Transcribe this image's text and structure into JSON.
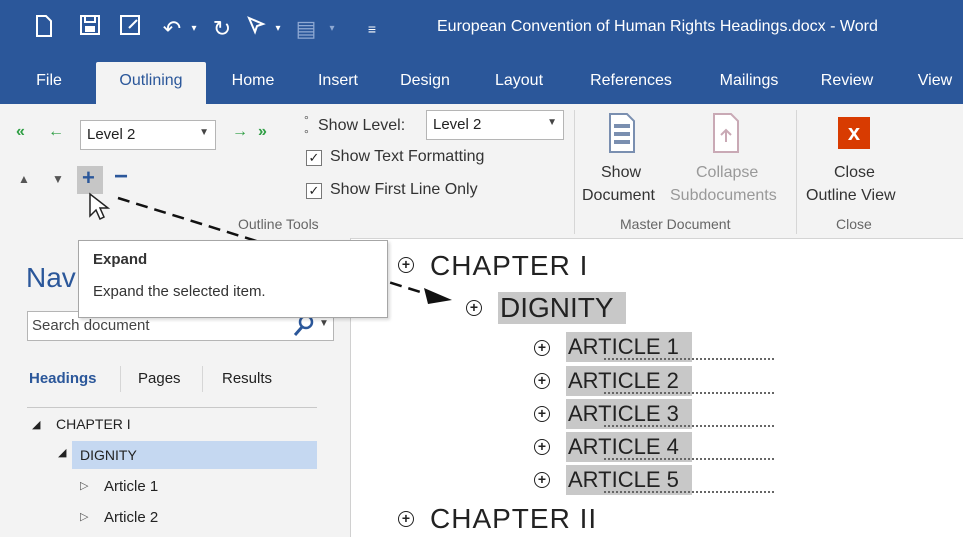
{
  "window": {
    "title": "European Convention of Human Rights Headings.docx  -  Word"
  },
  "tabs": [
    "File",
    "Outlining",
    "Home",
    "Insert",
    "Design",
    "Layout",
    "References",
    "Mailings",
    "Review",
    "View"
  ],
  "outline_tools": {
    "level_value": "Level 2",
    "show_level_label": "Show Level:",
    "show_level_value": "Level 2",
    "show_text_formatting": "Show Text Formatting",
    "show_first_line_only": "Show First Line Only",
    "group_label": "Outline Tools"
  },
  "master_document": {
    "show_document_line1": "Show",
    "show_document_line2": "Document",
    "collapse_line1": "Collapse",
    "collapse_line2": "Subdocuments",
    "group_label": "Master Document"
  },
  "close_group": {
    "close_line1": "Close",
    "close_line2": "Outline View",
    "group_label": "Close",
    "icon_glyph": "x"
  },
  "tooltip": {
    "title": "Expand",
    "body": "Expand the selected item."
  },
  "nav": {
    "title_partial": "Nav",
    "search_placeholder": "Search document",
    "tabs": [
      "Headings",
      "Pages",
      "Results"
    ],
    "tree": [
      {
        "label": "CHAPTER I",
        "arrow": "◢"
      },
      {
        "label": "DIGNITY",
        "arrow": "◢"
      },
      {
        "label": "Article 1",
        "arrow": "▷"
      },
      {
        "label": "Article 2",
        "arrow": "▷"
      }
    ]
  },
  "outline": {
    "chapter1": "CHAPTER I",
    "dignity": "DIGNITY",
    "articles": [
      "ARTICLE 1",
      "ARTICLE 2",
      "ARTICLE 3",
      "ARTICLE 4",
      "ARTICLE 5"
    ],
    "chapter2": "CHAPTER II"
  },
  "colors": {
    "word_blue": "#2b579a",
    "promote_green": "#2e9e43",
    "close_red": "#d83b01"
  }
}
